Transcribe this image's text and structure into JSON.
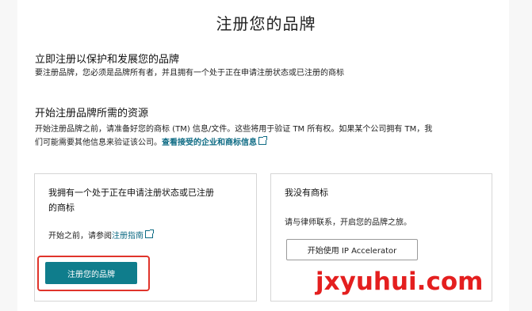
{
  "page": {
    "title": "注册您的品牌"
  },
  "section1": {
    "heading": "立即注册以保护和发展您的品牌",
    "body": "要注册品牌，您必须是品牌所有者，并且拥有一个处于正在申请注册状态或已注册的商标"
  },
  "section2": {
    "heading": "开始注册品牌所需的资源",
    "body_line1": "开始注册品牌之前，请准备好您的商标 (TM) 信息/文件。这些将用于验证 TM 所有权。如果某个公司拥有 TM，我",
    "body_line2": "们可能需要其他信息来验证该公司。",
    "link_label": "查看接受的企业和商标信息"
  },
  "card_has_tm": {
    "title_line1": "我拥有一个处于正在申请注册状态或已注册",
    "title_line2": "的商标",
    "before_text": "开始之前，请参阅",
    "guide_link": "注册指南",
    "button_label": "注册您的品牌"
  },
  "card_no_tm": {
    "title": "我没有商标",
    "body": "请与律师联系，开启您的品牌之旅。",
    "button_label": "开始使用 IP Accelerator"
  },
  "watermark": {
    "text": "jxyuhui.com"
  },
  "colors": {
    "primary_button": "#0f7d8c",
    "link": "#0e6b84",
    "highlight": "#e0342b",
    "watermark": "#e41f1f"
  },
  "icons": [
    "external-link-icon"
  ]
}
